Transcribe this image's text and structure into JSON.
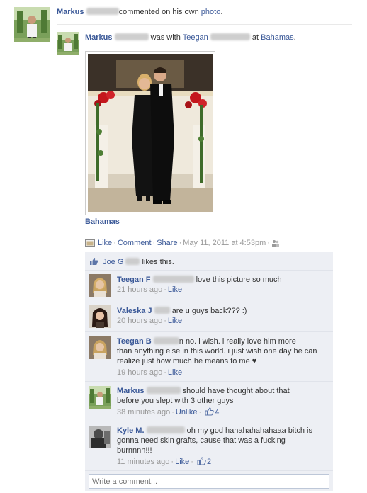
{
  "story": {
    "author": "Markus",
    "action": "commented on his own",
    "object": "photo",
    "end": "."
  },
  "post": {
    "author": "Markus",
    "with_text": "was with",
    "tagged": "Teegan",
    "at_text": "at",
    "place": "Bahamas",
    "end": ".",
    "album_title": "Bahamas"
  },
  "actions": {
    "like": "Like",
    "comment": "Comment",
    "share": "Share",
    "timestamp": "May 11, 2011 at 4:53pm"
  },
  "likes": {
    "name": "Joe G",
    "text": "likes this."
  },
  "comments": [
    {
      "author": "Teegan F",
      "text": "love this picture so much",
      "time": "21 hours ago",
      "like_label": "Like"
    },
    {
      "author": "Valeska J",
      "text": "are u guys back??? :)",
      "time": "20 hours ago",
      "like_label": "Like"
    },
    {
      "author": "Teegan B",
      "text_line1": "n no. i wish. i really love him more",
      "text_line2": "than anything else in this world. i just wish one day he can",
      "text_line3": "realize just how much he means to me ♥",
      "time": "19 hours ago",
      "like_label": "Like"
    },
    {
      "author": "Markus",
      "text_line1": "should have thought about that",
      "text_line2": "before you slept with 3 other guys",
      "time": "38 minutes ago",
      "like_label": "Unlike",
      "like_count": "4"
    },
    {
      "author": "Kyle M.",
      "text_line1": "oh my god hahahahahahaaa bitch is",
      "text_line2": "gonna need skin grafts, cause that was a fucking",
      "text_line3": "burnnnn!!!",
      "time": "11 minutes ago",
      "like_label": "Like",
      "like_count": "2"
    }
  ],
  "write_comment": {
    "placeholder": "Write a comment..."
  }
}
